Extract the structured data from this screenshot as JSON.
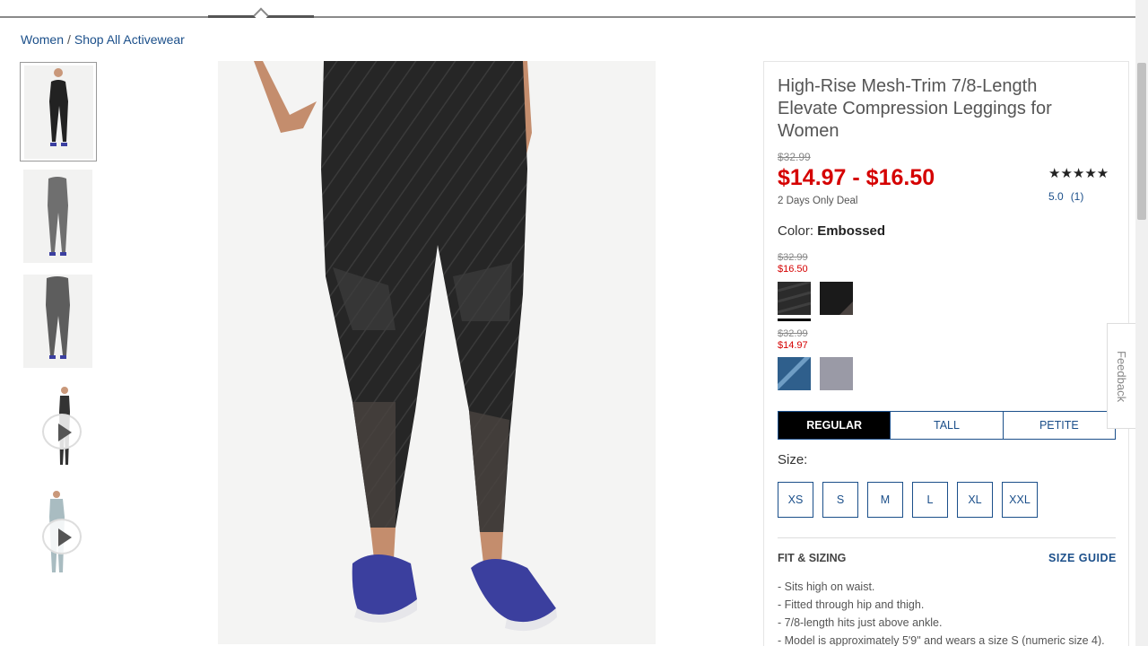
{
  "breadcrumb": {
    "items": [
      "Women",
      "Shop All Activewear"
    ],
    "separator": "/"
  },
  "product": {
    "title": "High-Rise Mesh-Trim 7/8-Length Elevate Compression Leggings for Women",
    "was_price": "$32.99",
    "sale_price": "$14.97 - $16.50",
    "deal_text": "2 Days Only Deal",
    "stars": "★★★★★",
    "rating_value": "5.0",
    "rating_count": "(1)"
  },
  "color": {
    "label": "Color:",
    "selected": "Embossed",
    "groups": [
      {
        "was": "$32.99",
        "now": "$16.50",
        "swatches": [
          {
            "name": "Embossed",
            "color": "#2b2b2b",
            "selected": true
          },
          {
            "name": "Black",
            "color": "#1a1a1a",
            "selected": false
          }
        ]
      },
      {
        "was": "$32.99",
        "now": "$14.97",
        "swatches": [
          {
            "name": "Blue",
            "color": "#2f5f8c",
            "selected": false
          },
          {
            "name": "Gray",
            "color": "#9a9aa6",
            "selected": false
          }
        ]
      }
    ]
  },
  "fit_tabs": [
    {
      "label": "REGULAR",
      "active": true
    },
    {
      "label": "TALL",
      "active": false
    },
    {
      "label": "PETITE",
      "active": false
    }
  ],
  "size": {
    "label": "Size:",
    "options": [
      "XS",
      "S",
      "M",
      "L",
      "XL",
      "XXL"
    ]
  },
  "fit_sizing": {
    "heading": "FIT & SIZING",
    "size_guide": "SIZE GUIDE",
    "bullets": [
      "Sits high on waist.",
      "Fitted through hip and thigh.",
      "7/8-length hits just above ankle.",
      "Model is approximately 5'9\" and wears a size S (numeric size 4)."
    ]
  },
  "thumbnails": [
    {
      "kind": "image",
      "selected": true
    },
    {
      "kind": "image",
      "selected": false
    },
    {
      "kind": "image",
      "selected": false
    },
    {
      "kind": "video",
      "selected": false
    },
    {
      "kind": "video",
      "selected": false
    }
  ],
  "feedback": "Feedback",
  "colors": {
    "accent": "#1b4f8a",
    "sale": "#d50000"
  }
}
